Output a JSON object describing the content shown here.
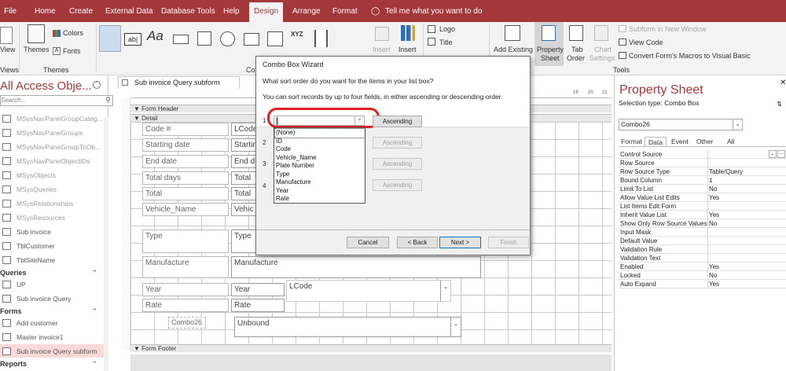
{
  "ribbon_tabs": [
    "File",
    "Home",
    "Create",
    "External Data",
    "Database Tools",
    "Help",
    "Design",
    "Arrange",
    "Format"
  ],
  "active_tab": "Design",
  "tell_me": "Tell me what you want to do",
  "ribbon": {
    "view_label": "View",
    "views_group": "Views",
    "themes_label": "Themes",
    "colors_label": "Colors",
    "fonts_label": "Fonts",
    "themes_group": "Themes",
    "controls_group_partial": "Co",
    "insert_label1": "Insert",
    "insert_label2": "Insert",
    "logo_label": "Logo",
    "title_label": "Title",
    "add_existing_label": "Add Existing",
    "property_label": "Property",
    "sheet_label": "Sheet",
    "tab_label": "Tab",
    "order_label": "Order",
    "chart_label": "Chart",
    "settings_label": "Settings",
    "subform_new_window": "Subform in New Window",
    "view_code": "View Code",
    "convert_macros": "Convert Form's Macros to Visual Basic",
    "tools_group": "Tools",
    "textbox_glyph": "ab|",
    "label_glyph": "Aa",
    "xyz_glyph": "XYZ"
  },
  "nav": {
    "title": "All Access Obje...",
    "search_placeholder": "Search...",
    "tables": [
      "MSysNavPaneGroupCateg...",
      "MSysNavPaneGroups",
      "MSysNavPaneGroupToOb...",
      "MSysNavPaneObjectIDs",
      "MSysObjects",
      "MSysQueries",
      "MSysRelationships",
      "MSysResources",
      "Sub invoice",
      "TblCustomer",
      "TblSiteName"
    ],
    "queries_header": "Queries",
    "queries": [
      "UP",
      "Sub invoice Query"
    ],
    "forms_header": "Forms",
    "forms": [
      "Add customer",
      "Master invoice1",
      "Sub invoice Query subform"
    ],
    "reports_header": "Reports"
  },
  "document": {
    "tab_title": "Sub invoice Query subform",
    "form_header": "Form Header",
    "detail": "Detail",
    "form_footer": "Form Footer",
    "ruler_marks": [
      "19",
      "20",
      "21"
    ],
    "labels": [
      "Code #",
      "Starting date",
      "End date",
      "Total days",
      "Total",
      "Vehicle_Name",
      "Type",
      "Manufacture",
      "Year",
      "Rate",
      "Combo26"
    ],
    "fields": [
      "LCode",
      "Startin",
      "End d",
      "Total",
      "Total",
      "Vehic",
      "Type",
      "Manufacture",
      "Year",
      "Rate",
      "LCode",
      "Unbound"
    ]
  },
  "wizard": {
    "title": "Combo Box Wizard",
    "question": "What sort order do you want for the items in your list box?",
    "instruction": "You can sort records by up to four fields, in either ascending or descending order.",
    "row_numbers": [
      "1",
      "2",
      "3",
      "4"
    ],
    "sort_button": "Ascending",
    "options": [
      "(None)",
      "ID",
      "Code",
      "Vehicle_Name",
      "Plate Number",
      "Type",
      "Manufacture",
      "Year",
      "Rate"
    ],
    "cancel": "Cancel",
    "back": "< Back",
    "next": "Next >",
    "finish": "Finish"
  },
  "property_sheet": {
    "title": "Property Sheet",
    "selection_type": "Selection type:  Combo Box",
    "selected_object": "Combo26",
    "tabs": [
      "Format",
      "Data",
      "Event",
      "Other",
      "All"
    ],
    "active_tab": "Data",
    "properties": [
      {
        "name": "Control Source",
        "value": ""
      },
      {
        "name": "Row Source",
        "value": ""
      },
      {
        "name": "Row Source Type",
        "value": "Table/Query"
      },
      {
        "name": "Bound Column",
        "value": "1"
      },
      {
        "name": "Limit To List",
        "value": "No"
      },
      {
        "name": "Allow Value List Edits",
        "value": "Yes"
      },
      {
        "name": "List Items Edit Form",
        "value": ""
      },
      {
        "name": "Inherit Value List",
        "value": "Yes"
      },
      {
        "name": "Show Only Row Source Values",
        "value": "No"
      },
      {
        "name": "Input Mask",
        "value": ""
      },
      {
        "name": "Default Value",
        "value": ""
      },
      {
        "name": "Validation Rule",
        "value": ""
      },
      {
        "name": "Validation Text",
        "value": ""
      },
      {
        "name": "Enabled",
        "value": "Yes"
      },
      {
        "name": "Locked",
        "value": "No"
      },
      {
        "name": "Auto Expand",
        "value": "Yes"
      }
    ]
  },
  "colors": {
    "accent": "#a4373a",
    "highlight_circle": "#e02020",
    "selected_nav": "#f9d9d9"
  }
}
